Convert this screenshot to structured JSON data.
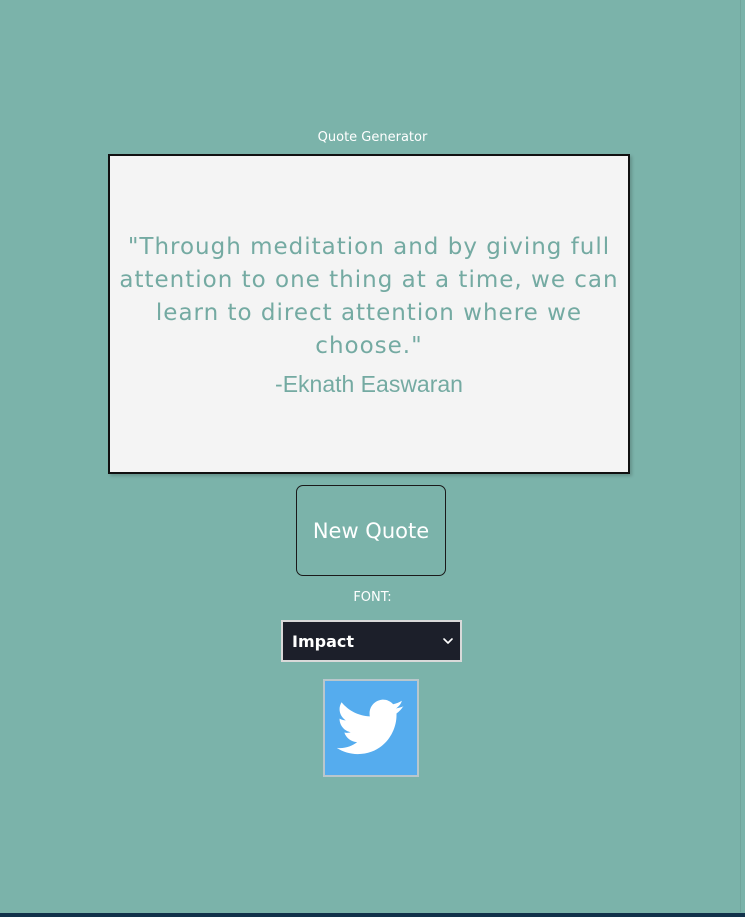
{
  "app": {
    "title": "Quote Generator"
  },
  "quote": {
    "text": "\"Through meditation and by giving full attention to one thing at a time, we can learn to direct attention where we choose.\"",
    "author": "-Eknath Easwaran"
  },
  "controls": {
    "new_quote_label": "New Quote",
    "font_label": "FONT:",
    "font_selected": "Impact"
  },
  "share": {
    "icon": "twitter-bird-icon"
  },
  "colors": {
    "background": "#7bb3aa",
    "card": "#f4f4f4",
    "quote_text": "#74aaa2",
    "select_bg": "#1c1f2a",
    "twitter_blue": "#55acee"
  }
}
